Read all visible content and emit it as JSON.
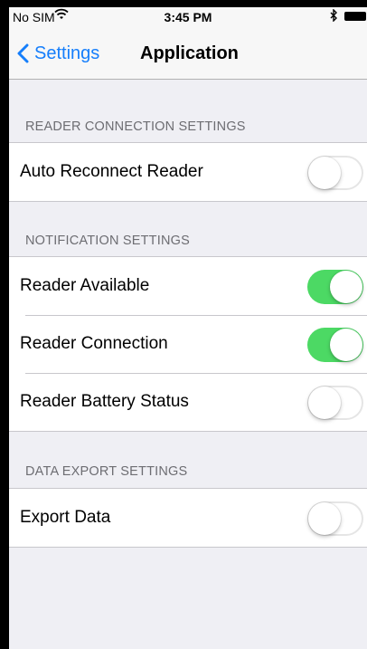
{
  "status_bar": {
    "carrier": "No SIM",
    "time": "3:45 PM"
  },
  "nav": {
    "back_label": "Settings",
    "title": "Application"
  },
  "sections": [
    {
      "header": "READER CONNECTION SETTINGS",
      "rows": [
        {
          "label": "Auto Reconnect Reader",
          "on": false
        }
      ]
    },
    {
      "header": "NOTIFICATION SETTINGS",
      "rows": [
        {
          "label": "Reader Available",
          "on": true
        },
        {
          "label": "Reader Connection",
          "on": true
        },
        {
          "label": "Reader Battery Status",
          "on": false
        }
      ]
    },
    {
      "header": "DATA EXPORT SETTINGS",
      "rows": [
        {
          "label": "Export Data",
          "on": false
        }
      ]
    }
  ],
  "colors": {
    "accent": "#157efb",
    "switch_on": "#4cd964",
    "background": "#efeff4"
  }
}
